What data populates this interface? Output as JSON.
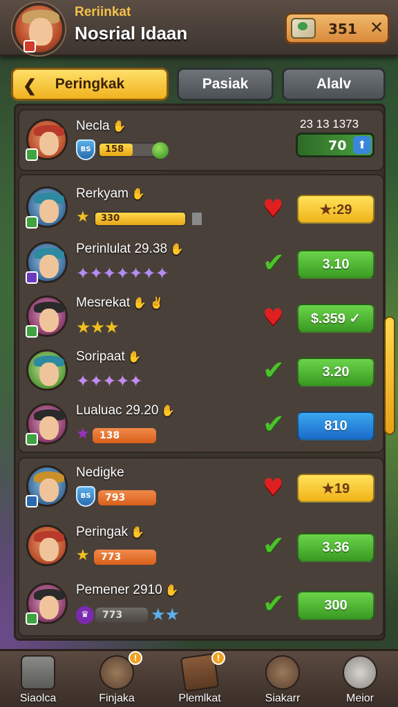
{
  "header": {
    "subtitle": "Reriinkat",
    "title": "Nosrial Idaan",
    "currency_amount": "351",
    "close_symbol": "✕"
  },
  "tabs": [
    {
      "label": "Peringkak",
      "active": true
    },
    {
      "label": "Pasiak",
      "active": false
    },
    {
      "label": "Alalv",
      "active": false
    }
  ],
  "player": {
    "name": "Necla",
    "level_badge": "BS",
    "level_value": "158",
    "rank_number": "23 13 1373",
    "rank_score": "70",
    "rank_progress": 0.55
  },
  "leaderboard": [
    {
      "name": "Rerkyam",
      "pill": "330",
      "pill_style": "gold",
      "status": "heart",
      "score": "★:29",
      "score_color": "yellow",
      "stars": "★",
      "progress": 0.75
    },
    {
      "name": "Perinlulat 29.38",
      "status": "check",
      "score": "3.10",
      "score_color": "green",
      "stars": "✦✦✦✦✦✦✦"
    },
    {
      "name": "Mesrekat",
      "status": "heart",
      "score": "$.359 ✓",
      "score_color": "green",
      "stars": "★★★"
    },
    {
      "name": "Soripaat",
      "status": "check",
      "score": "3.20",
      "score_color": "green",
      "stars": "✦✦✦✦✦"
    },
    {
      "name": "Lualuac 29.20",
      "pill": "138",
      "pill_style": "orange",
      "status": "check",
      "score": "810",
      "score_color": "blue",
      "stars": "★"
    }
  ],
  "leaderboard2": [
    {
      "name": "Nedigke",
      "pill": "793",
      "pill_style": "orange",
      "status": "heart",
      "score": "★19",
      "score_color": "yellow"
    },
    {
      "name": "Peringak",
      "pill": "773",
      "pill_style": "orange",
      "status": "check",
      "score": "3.36",
      "score_color": "green",
      "stars": "★"
    },
    {
      "name": "Pemener 2910",
      "pill": "773",
      "pill_style": "gray",
      "status": "check",
      "score": "300",
      "score_color": "green",
      "stars": "★★"
    }
  ],
  "nav": [
    {
      "label": "Siaolca",
      "icon": "house-icon"
    },
    {
      "label": "Finjaka",
      "icon": "character-icon",
      "alert": "!"
    },
    {
      "label": "Plemlkat",
      "icon": "book-icon",
      "alert": "!"
    },
    {
      "label": "Siakarr",
      "icon": "explorer-icon"
    },
    {
      "label": "Meior",
      "icon": "gear-icon"
    }
  ],
  "colors": {
    "accent": "#f0b21e",
    "green": "#3a9a22",
    "blue": "#1a6ac8",
    "heart": "#e02020"
  }
}
